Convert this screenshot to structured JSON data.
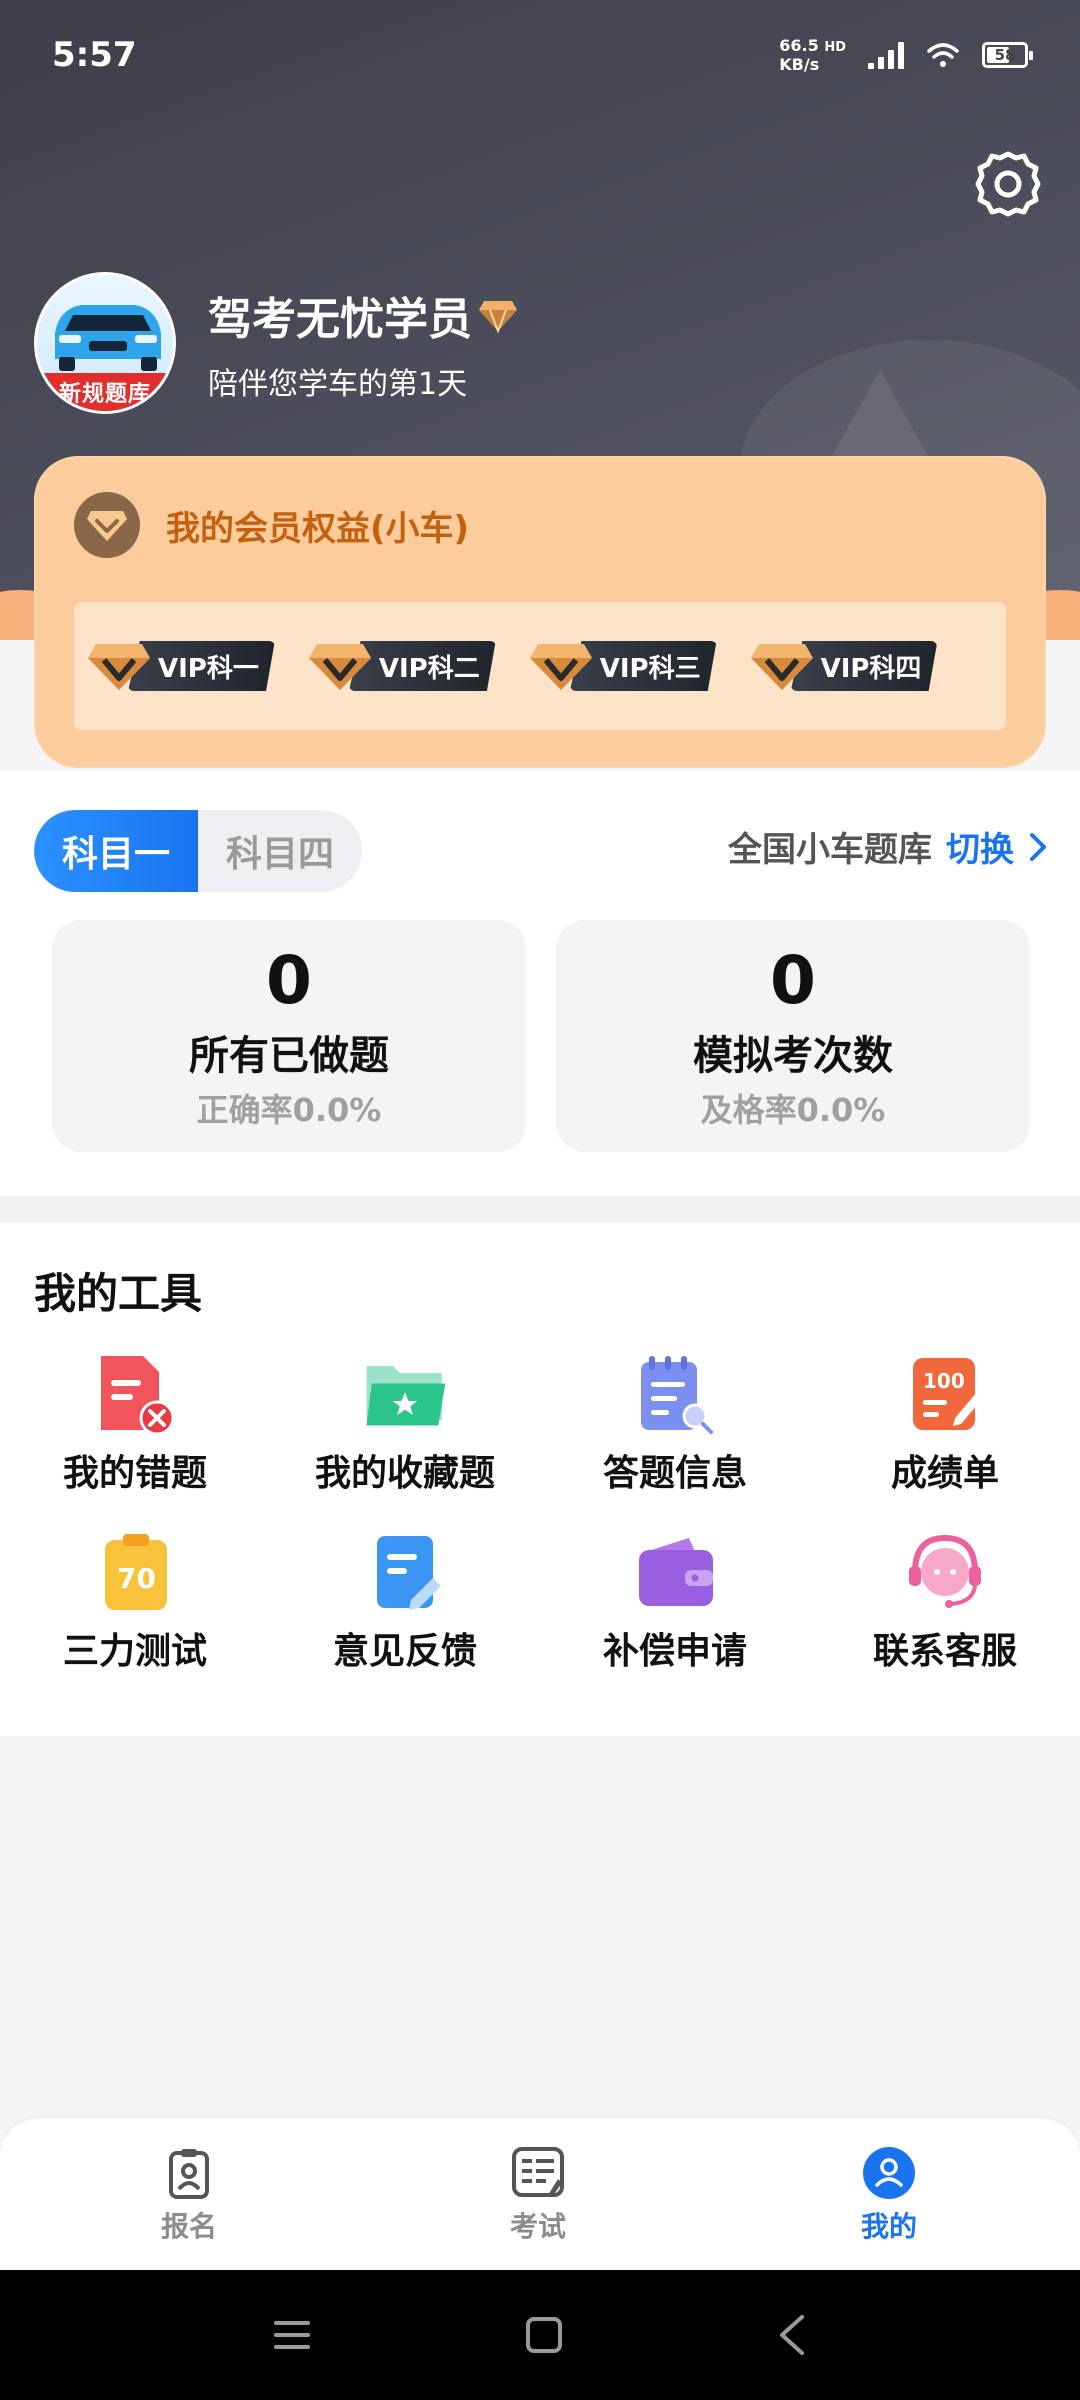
{
  "status_bar": {
    "time": "5:57",
    "net_speed_value": "66.5",
    "net_speed_unit": "KB/s",
    "net_type": "HD",
    "battery": "58"
  },
  "profile": {
    "name": "驾考无忧学员",
    "subtitle": "陪伴您学车的第1天",
    "avatar_banner": "新规题库"
  },
  "vip": {
    "title": "我的会员权益(小车)",
    "tags": [
      "VIP科一",
      "VIP科二",
      "VIP科三",
      "VIP科四"
    ]
  },
  "subjects": {
    "tabs": [
      "科目一",
      "科目四"
    ],
    "active": "科目一",
    "bank_label": "全国小车题库",
    "switch_label": "切换"
  },
  "stats": [
    {
      "value": "0",
      "label": "所有已做题",
      "sub": "正确率0.0%"
    },
    {
      "value": "0",
      "label": "模拟考次数",
      "sub": "及格率0.0%"
    }
  ],
  "tools": {
    "title": "我的工具",
    "items": [
      {
        "label": "我的错题",
        "icon": "wrong-questions-icon"
      },
      {
        "label": "我的收藏题",
        "icon": "favorite-folder-icon"
      },
      {
        "label": "答题信息",
        "icon": "answer-info-icon"
      },
      {
        "label": "成绩单",
        "icon": "score-sheet-icon"
      },
      {
        "label": "三力测试",
        "icon": "three-ability-test-icon"
      },
      {
        "label": "意见反馈",
        "icon": "feedback-icon"
      },
      {
        "label": "补偿申请",
        "icon": "compensation-wallet-icon"
      },
      {
        "label": "联系客服",
        "icon": "customer-service-icon"
      }
    ]
  },
  "bottom_nav": [
    {
      "label": "报名",
      "icon": "register-icon"
    },
    {
      "label": "考试",
      "icon": "exam-icon"
    },
    {
      "label": "我的",
      "icon": "profile-icon",
      "active": true
    }
  ],
  "colors": {
    "accent": "#1a74f0",
    "vip_card": "#fdcc9d",
    "vip_title": "#c4610f",
    "header_dark": "#45464f"
  }
}
